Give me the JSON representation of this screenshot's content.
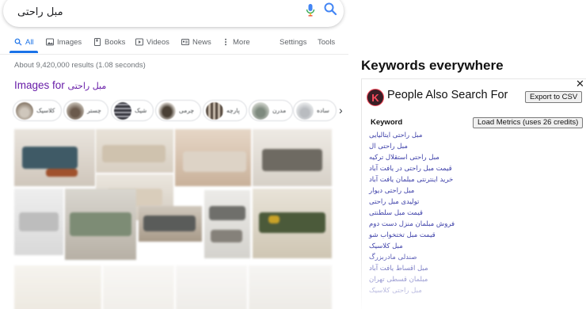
{
  "search": {
    "query": "مبل راحتی"
  },
  "tabs": {
    "all": "All",
    "images": "Images",
    "books": "Books",
    "videos": "Videos",
    "news": "News",
    "more": "More",
    "settings": "Settings",
    "tools": "Tools"
  },
  "results": {
    "stats": "About 9,420,000 results (1.08 seconds)"
  },
  "images_section": {
    "heading_prefix": "Images for",
    "heading_query": "مبل راحتی",
    "chips": [
      "کلاسیک",
      "چستر",
      "شیک",
      "چرمی",
      "پارچه",
      "مدرن",
      "ساده"
    ]
  },
  "keywords_everywhere": {
    "title": "Keywords everywhere",
    "panel_title": "People Also Search For",
    "logo_letter": "K",
    "export_button": "Export to CSV",
    "column_header": "Keyword",
    "load_metrics_button": "Load Metrics (uses 26 credits)",
    "keywords": [
      "مبل راحتی ایتالیایی",
      "مبل راحتی ال",
      "مبل راحتی استقلال ترکیه",
      "قیمت مبل راحتی در یافت آباد",
      "خرید اینترنتی مبلمان یافت آباد",
      "مبل راحتی دیوار",
      "تولیدی مبل راحتی",
      "قیمت مبل سلطنتی",
      "فروش مبلمان منزل دست دوم",
      "قیمت مبل تختخواب شو",
      "مبل کلاسیک",
      "صندلی مادربزرگ",
      "مبل اقساط یافت آباد",
      "مبلمان قسطی تهران",
      "مبل راحتی کلاسیک"
    ]
  },
  "colors": {
    "link_blue": "#1a73e8",
    "visited_purple": "#681da8",
    "keyword_blue": "#3b3ea8",
    "logo_red": "#ff4d5e"
  }
}
